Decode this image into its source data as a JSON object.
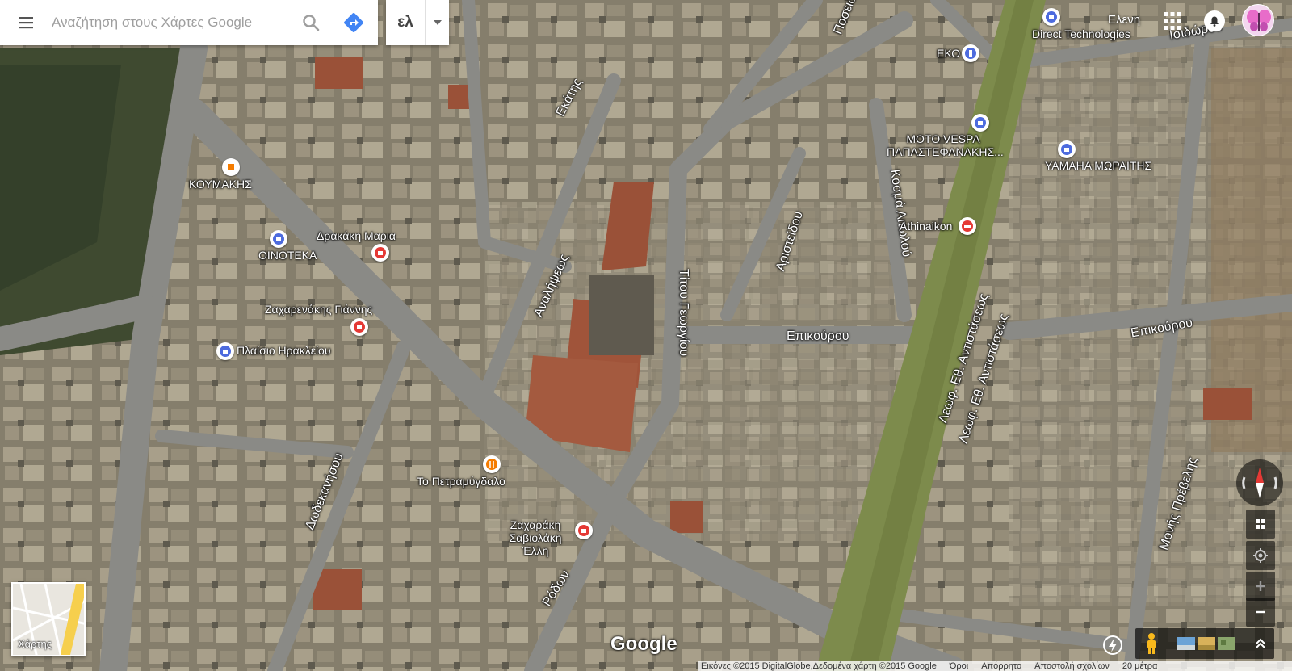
{
  "search": {
    "placeholder": "Αναζήτηση στους Χάρτες Google"
  },
  "language": {
    "label": "ελ"
  },
  "account": {
    "name": "Ελενη"
  },
  "streets": [
    {
      "name": "Εκάτης"
    },
    {
      "name": "Αναλήψεως"
    },
    {
      "name": "Τίτου Γεωργίου"
    },
    {
      "name": "Αριστείδου"
    },
    {
      "name": "Κοσμά Αιτωλού"
    },
    {
      "name": "Επικούρου"
    },
    {
      "name": "Επικούρου"
    },
    {
      "name": "Λεωφ. Εθ. Αντιστάσεως"
    },
    {
      "name": "Λεωφ. Εθ. Αντιστάσεως"
    },
    {
      "name": "Δωδεκανήσου"
    },
    {
      "name": "Ρόδων"
    },
    {
      "name": "Μονής Πρέβελης"
    },
    {
      "name": "Ισιδώρου"
    },
    {
      "name": "Ποσειδ"
    }
  ],
  "pois": [
    {
      "name": "ΚΟΥΜΑΚΗΣ",
      "icon": "shop-icon",
      "color": "#f57c00"
    },
    {
      "name": "ΟΙΝΟΤΕΚΑ",
      "icon": "shopping-bag-icon",
      "color": "#4d6bde"
    },
    {
      "name": "Δρακάκη Μαρια",
      "icon": "gift-icon",
      "color": "#e53935"
    },
    {
      "name": "Ζαχαρενάκης Γιάννης",
      "icon": "gift-icon",
      "color": "#e53935"
    },
    {
      "name": "Πλαίσιο Ηρακλείου",
      "icon": "shopping-bag-icon",
      "color": "#4d6bde"
    },
    {
      "name": "Το Πετραμύγδαλο",
      "icon": "restaurant-icon",
      "color": "#f57c00"
    },
    {
      "name": "Ζαχαράκη Σαβιολάκη Έλλη",
      "icon": "gift-icon",
      "color": "#e53935"
    },
    {
      "name": "Direct Technologies",
      "icon": "shopping-bag-icon",
      "color": "#4d6bde"
    },
    {
      "name": "ΕΚΟ",
      "icon": "gas-station-icon",
      "color": "#4d6bde"
    },
    {
      "name": "MOTO VESPA ΠΑΠΑΣΤΕΦΑΝΑΚΗΣ...",
      "icon": "shopping-bag-icon",
      "color": "#4d6bde"
    },
    {
      "name": "YAMAHA ΜΩΡΑΙΤΗΣ",
      "icon": "shopping-bag-icon",
      "color": "#4d6bde"
    },
    {
      "name": "Athinaikon",
      "icon": "hotel-icon",
      "color": "#e53935"
    }
  ],
  "minimap": {
    "label": "Χάρτης"
  },
  "branding": {
    "logo": "Google"
  },
  "footer": {
    "imagery": "Εικόνες ©2015 DigitalGlobe,Δεδομένα χάρτη ©2015 Google",
    "terms": "Όροι",
    "privacy": "Απόρρητο",
    "feedback": "Αποστολή σχολίων",
    "scale": "20 μέτρα"
  }
}
